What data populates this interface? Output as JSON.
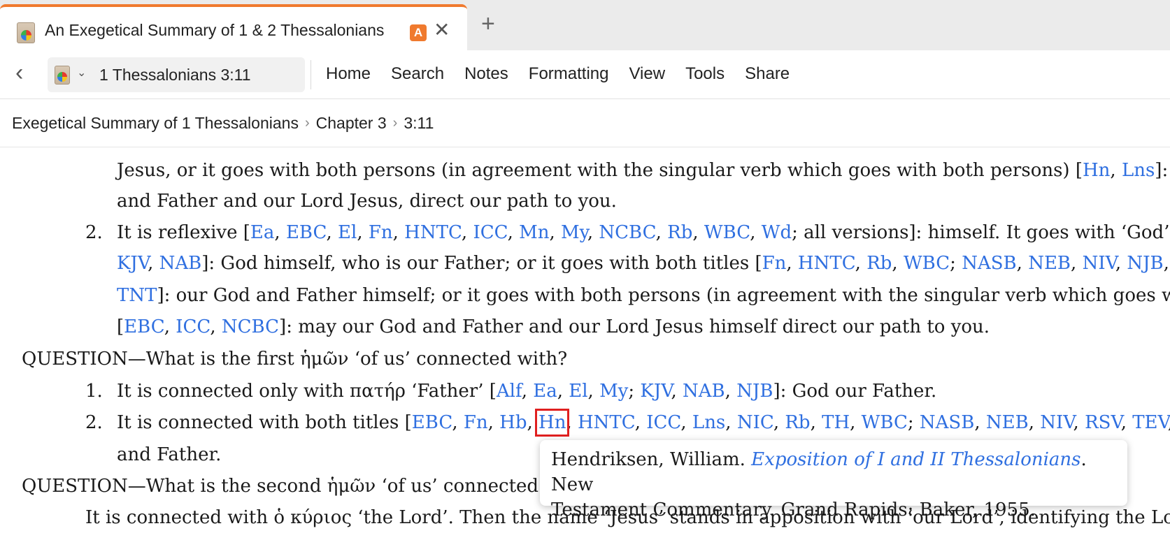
{
  "tab": {
    "title": "An Exegetical Summary of 1 & 2 Thessalonians",
    "badge": "A",
    "close": "✕",
    "new_tab": "+"
  },
  "toolbar": {
    "back": "‹",
    "reference": "1 Thessalonians 3:11",
    "chevron": "⌄",
    "menu": [
      "Home",
      "Search",
      "Notes",
      "Formatting",
      "View",
      "Tools",
      "Share"
    ]
  },
  "breadcrumb": {
    "items": [
      "Exegetical Summary of 1 Thessalonians",
      "Chapter 3",
      "3:11"
    ],
    "sep": "›"
  },
  "doc": {
    "l0": {
      "a": "Jesus, or it goes with both persons (in agreement with the singular verb which goes with both persons) [",
      "k1": "Hn",
      "c1": ", ",
      "k2": "Lns",
      "b": "]: may"
    },
    "l1": "and Father and our Lord Jesus, direct our path to you.",
    "n2": "2.",
    "l2": {
      "a": "It is reflexive [",
      "links": [
        "Ea",
        "EBC",
        "El",
        "Fn",
        "HNTC",
        "ICC",
        "Mn",
        "My",
        "NCBC",
        "Rb",
        "WBC",
        "Wd"
      ],
      "b": "; all versions]: himself. It goes with ‘God’ [",
      "k_end": "E"
    },
    "l3": {
      "k1": "KJV",
      "c1": ", ",
      "k2": "NAB",
      "a": "]: God himself, who is our Father; or it goes with both titles [",
      "links1": [
        "Fn",
        "HNTC",
        "Rb",
        "WBC"
      ],
      "semi": "; ",
      "links2": [
        "NASB",
        "NEB",
        "NIV",
        "NJB"
      ],
      "k_end": "R"
    },
    "l4": {
      "k1": "TNT",
      "a": "]: our God and Father himself; or it goes with both persons (in agreement with the singular verb which goes with"
    },
    "l5": {
      "a": "[",
      "links": [
        "EBC",
        "ICC",
        "NCBC"
      ],
      "b": "]: may our God and Father and our Lord Jesus himself direct our path to you."
    },
    "q1": "QUESTION—What is the first ἡμῶν ‘of us’ connected with?",
    "n6": "1.",
    "l6": {
      "a": "It is connected only with πατήρ ‘Father’ [",
      "links1": [
        "Alf",
        "Ea",
        "El",
        "My"
      ],
      "semi": "; ",
      "links2": [
        "KJV",
        "NAB",
        "NJB"
      ],
      "b": "]: God our Father."
    },
    "n7": "2.",
    "l7": {
      "a": "It is connected with both titles [",
      "k1": "EBC",
      "k2": "Fn",
      "k3": "Hb",
      "k_hl": "Hn",
      "links": [
        "HNTC",
        "ICC",
        "Lns",
        "NIC",
        "Rb",
        "TH",
        "WBC"
      ],
      "semi": "; ",
      "links2": [
        "NASB",
        "NEB",
        "NIV",
        "RSV",
        "TEV"
      ],
      "k_end": "T"
    },
    "l8": "and Father.",
    "q2": "QUESTION—What is the second ἡμῶν ‘of us’ connected w",
    "l9": "It is connected with ὁ κύριος ‘the Lord’. Then the name ‘Jesus’ stands in apposition with ‘our Lord’, identifying the Lord to"
  },
  "tooltip": {
    "author": "Hendriksen, William. ",
    "title": "Exposition of I and II Thessalonians",
    "rest1": ". New",
    "line2": "Testament Commentary. Grand Rapids: Baker, 1955."
  }
}
